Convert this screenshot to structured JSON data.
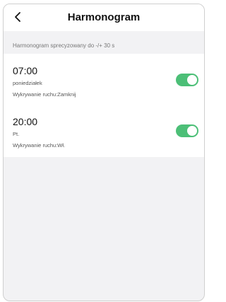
{
  "header": {
    "title": "Harmonogram",
    "back_icon": "chevron-left-icon"
  },
  "info": {
    "text": "Harmonogram sprecyzowany do -/+ 30 s"
  },
  "schedules": [
    {
      "time": "07:00",
      "day": "poniedziałek",
      "motion": "Wykrywanie ruchu:Zamknij",
      "enabled": true
    },
    {
      "time": "20:00",
      "day": "Pt.",
      "motion": "Wykrywanie ruchu:Wł.",
      "enabled": true
    }
  ],
  "colors": {
    "toggle_on": "#4cbf77",
    "background": "#f2f2f4"
  }
}
